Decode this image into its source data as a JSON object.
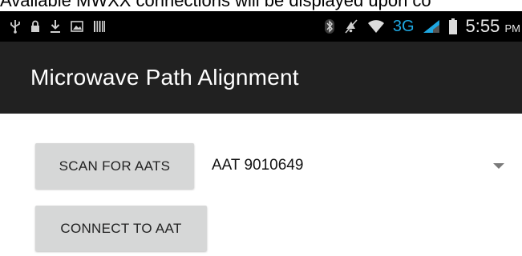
{
  "caption": "Available MWXX connections will be displayed upon co",
  "status_bar": {
    "left_icons": [
      "usb-icon",
      "lock-icon",
      "download-icon",
      "image-icon",
      "barcode-icon"
    ],
    "right_icons": [
      "bluetooth-icon",
      "mute-icon",
      "wifi-icon",
      "signal-icon",
      "battery-icon"
    ],
    "network": "3G",
    "time": "5:55",
    "ampm": "PM",
    "accent_color": "#1ea7e1"
  },
  "app_bar": {
    "title": "Microwave Path Alignment",
    "background": "#212121"
  },
  "controls": {
    "scan_button": "SCAN FOR AATS",
    "selected_aat": "AAT 9010649",
    "connect_button": "CONNECT TO AAT"
  }
}
